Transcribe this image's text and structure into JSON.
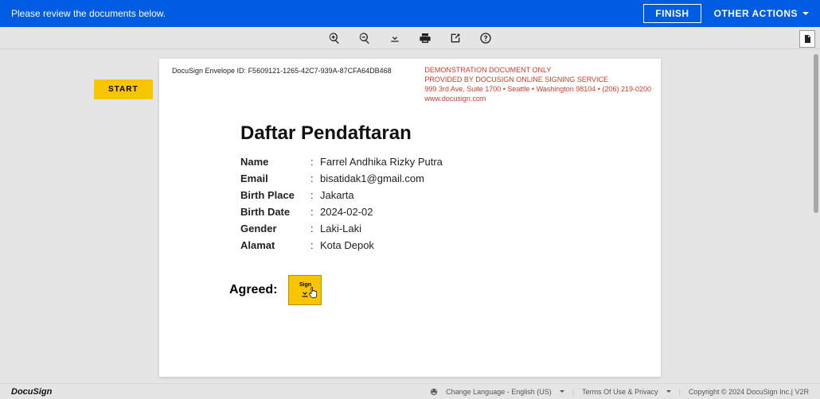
{
  "header": {
    "message": "Please review the documents below.",
    "finish_label": "FINISH",
    "other_actions_label": "OTHER ACTIONS"
  },
  "toolbar": {
    "zoom_in": "zoom-in",
    "zoom_out": "zoom-out",
    "download": "download",
    "print": "print",
    "assign": "assign",
    "help": "help"
  },
  "start_label": "START",
  "envelope": {
    "prefix": "DocuSign Envelope ID: ",
    "id": "F5609121-1265-42C7-939A-87CFA64DB468"
  },
  "demo": {
    "l1": "DEMONSTRATION DOCUMENT ONLY",
    "l2": "PROVIDED BY DOCUSIGN ONLINE SIGNING SERVICE",
    "l3": "999 3rd Ave, Suite 1700 • Seattle • Washington 98104 • (206) 219-0200",
    "l4": "www.docusign.com"
  },
  "document": {
    "title": "Daftar Pendaftaran",
    "fields": [
      {
        "label": "Name",
        "value": "Farrel Andhika Rizky Putra"
      },
      {
        "label": "Email",
        "value": "bisatidak1@gmail.com"
      },
      {
        "label": "Birth Place",
        "value": "Jakarta"
      },
      {
        "label": "Birth Date",
        "value": "2024-02-02"
      },
      {
        "label": "Gender",
        "value": "Laki-Laki"
      },
      {
        "label": "Alamat",
        "value": "Kota Depok"
      }
    ],
    "agreed_label": "Agreed:",
    "sign_label": "Sign"
  },
  "footer": {
    "brand": "DocuSign",
    "language": "Change Language - English (US)",
    "terms": "Terms Of Use & Privacy",
    "copyright": "Copyright © 2024 DocuSign Inc.| V2R"
  }
}
